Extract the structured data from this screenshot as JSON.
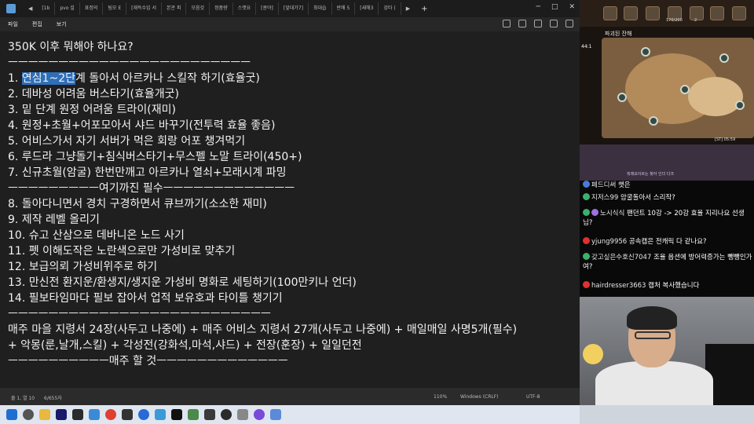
{
  "tabs": {
    "items": [
      "[1b",
      "pvo 설",
      "표정의",
      "팀모 E",
      "[재득수입 서",
      "본관 피",
      "모음것",
      "정품량",
      "스맷요",
      "[콩야]",
      "[앞대가7]",
      "최대습",
      "반매 5",
      "[새해3",
      "강타 ("
    ],
    "add": "+"
  },
  "menu": {
    "file": "파일",
    "edit": "편집",
    "view": "보기"
  },
  "editor": {
    "lines": [
      "350K 이후 뭐해야 하나요?",
      "ㅡㅡㅡㅡㅡㅡㅡㅡㅡㅡㅡㅡㅡㅡㅡㅡㅡㅡㅡㅡㅡㅡㅡㅡ",
      "1. ",
      "2. 데바성 어려움 버스타기(효율개굿)",
      "3. 밑 단계 원정 어려움 트라이(재미)",
      "4. 원정+초월+어포모아서 샤드 바꾸기(전투력 효율 좋음)",
      "5. 어비스가서 자기 서버가 먹은 회랑 어포 챙겨먹기",
      "6. 루드라 그냥돌기+침식버스타기+무스펠 노말 트라이(450+)",
      "7. 신규초월(암굴) 한번만깨고 아르카나 열쇠+모래시계 파밍",
      "ㅡㅡㅡㅡㅡㅡㅡㅡㅡ여기까진 필수ㅡㅡㅡㅡㅡㅡㅡㅡㅡㅡㅡㅡㅡ",
      "8. 돌아다니면서 경치 구경하면서 큐브까기(소소한 재미)",
      "9. 제작 레벨 올리기",
      "10. 슈고 산삼으로 데바니온 노드 사기",
      "11. 펫 이해도작은 노란색으로만 가성비로 맞추기",
      "12. 보급의뢰 가성비위주로 하기",
      "13. 만신전 환지운/환생지/생지운 가성비 명화로 세팅하기(100만키나 언더)",
      "14. 필보타임마다 필보 잡아서 업적 보유호과 타이틀 챙기기",
      "ㅡㅡㅡㅡㅡㅡㅡㅡㅡㅡㅡㅡㅡㅡㅡㅡㅡㅡㅡㅡㅡㅡㅡㅡㅡㅡ",
      "매주 마을 지령서 24장(사두고 나중에) + 매주 어비스 지령서 27개(사두고 나중에) + 매일매일 사명5개(필수)",
      "+ 악몽(룬,날개,스킬) + 각성전(강화석,마석,샤드) + 전장(훈장) + 일일던전",
      "ㅡㅡㅡㅡㅡㅡㅡㅡㅡㅡ매주 할 것ㅡㅡㅡㅡㅡㅡㅡㅡㅡㅡㅡㅡㅡ"
    ],
    "line1_selected": "연심1~2단",
    "line1_rest": "계 돌아서 아르카나 스킬작 하기(효율굿)"
  },
  "status": {
    "position": "줄 1, 열 10",
    "chars": "6/655자",
    "zoom": "110%",
    "eol": "Windows (CRLF)",
    "encoding": "UTF-8"
  },
  "game": {
    "map_title": "파괴된 잔해",
    "side_time": "44:1",
    "clock": "[ST] 05:59",
    "counters": [
      "170/200",
      "2"
    ],
    "banner": "뭐래요이르는 찾아 인더 다크"
  },
  "chat": [
    {
      "nick": "페드디써",
      "text": " 햇은"
    },
    {
      "nick": "지저스99",
      "text": " 암굴돌아서 스리작?"
    },
    {
      "nick": "노시식식",
      "text": " 팬던트 10강 -> 20강 효율 지리나요 선생님?"
    },
    {
      "nick": "yjung9956",
      "text": " 공속캡은 전캐릭 다 같나요?"
    },
    {
      "nick": "갖고싶은수호신7047",
      "text": " 조율 옵션에 방어력증가는 뺑뺑인가여?"
    },
    {
      "nick": "hairdresser3663",
      "text": " 캡처 복사했습니다"
    }
  ],
  "colors": {
    "selection": "#2f6fb8",
    "editor_bg": "#1f1f1f",
    "taskbar_bg": "#dfe6ef"
  }
}
